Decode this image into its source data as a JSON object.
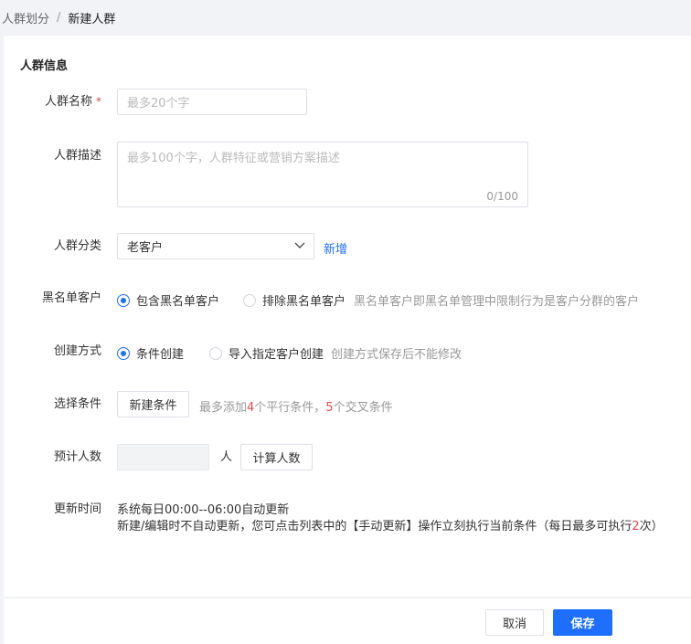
{
  "breadcrumb": {
    "parent": "人群划分",
    "separator": "/",
    "current": "新建人群"
  },
  "section": {
    "title": "人群信息"
  },
  "name_field": {
    "label": "人群名称",
    "required_mark": "*",
    "placeholder": "最多20个字"
  },
  "desc_field": {
    "label": "人群描述",
    "placeholder": "最多100个字，人群特征或营销方案描述",
    "counter": "0/100"
  },
  "category_field": {
    "label": "人群分类",
    "selected": "老客户",
    "add_link": "新增"
  },
  "blacklist_field": {
    "label": "黑名单客户",
    "options": [
      "包含黑名单客户",
      "排除黑名单客户"
    ],
    "selected_index": 0,
    "hint": "黑名单客户即黑名单管理中限制行为是客户分群的客户"
  },
  "create_method_field": {
    "label": "创建方式",
    "options": [
      "条件创建",
      "导入指定客户创建"
    ],
    "selected_index": 0,
    "hint": "创建方式保存后不能修改"
  },
  "condition_field": {
    "label": "选择条件",
    "button": "新建条件",
    "hint_prefix": "最多添加",
    "hint_num1": "4",
    "hint_mid": "个平行条件，",
    "hint_num2": "5",
    "hint_suffix": "个交叉条件"
  },
  "estimate_field": {
    "label": "预计人数",
    "unit": "人",
    "button": "计算人数"
  },
  "update_field": {
    "label": "更新时间",
    "line1": "系统每日00:00--06:00自动更新",
    "line2_prefix": "新建/编辑时不自动更新，您可点击列表中的【手动更新】操作立刻执行当前条件（每日最多可执行",
    "line2_num": "2",
    "line2_suffix": "次）"
  },
  "footer": {
    "cancel": "取消",
    "save": "保存"
  },
  "colors": {
    "primary": "#1e6fff",
    "required": "#e5484d"
  }
}
